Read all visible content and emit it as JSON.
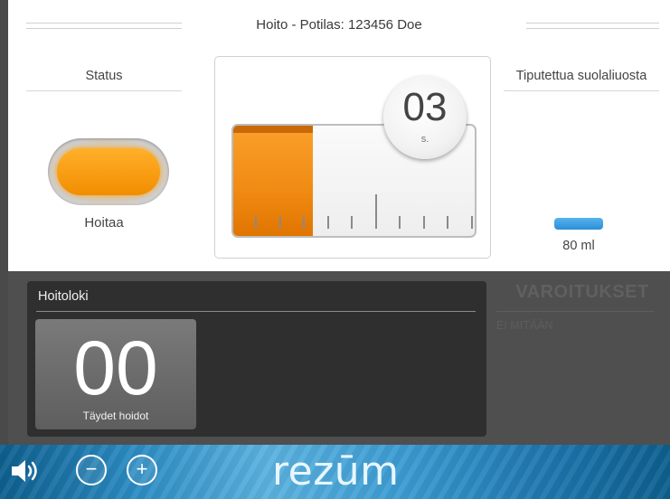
{
  "header": {
    "title": "Hoito - Potilas: 123456 Doe"
  },
  "status": {
    "heading": "Status",
    "value": "Hoitaa",
    "indicator_color": "#f7941d"
  },
  "treatment_timer": {
    "value": "03",
    "unit": "s.",
    "progress_fraction": 0.33
  },
  "saline": {
    "heading": "Tiputettua suolaliuosta",
    "value": "80 ml",
    "bar_color": "#2b8fd6"
  },
  "log": {
    "title": "Hoitoloki",
    "count": "00",
    "count_label": "Täydet hoidot"
  },
  "warnings": {
    "title": "VAROITUKSET",
    "value": "EI MITÄÄN"
  },
  "footer": {
    "speaker_icon": "speaker-icon",
    "minus_label": "−",
    "plus_label": "+",
    "logo_text": "rezūm"
  },
  "colors": {
    "accent_orange": "#f28d00",
    "saline_blue": "#2b8fd6",
    "panel_dark": "#2f2f2f"
  }
}
